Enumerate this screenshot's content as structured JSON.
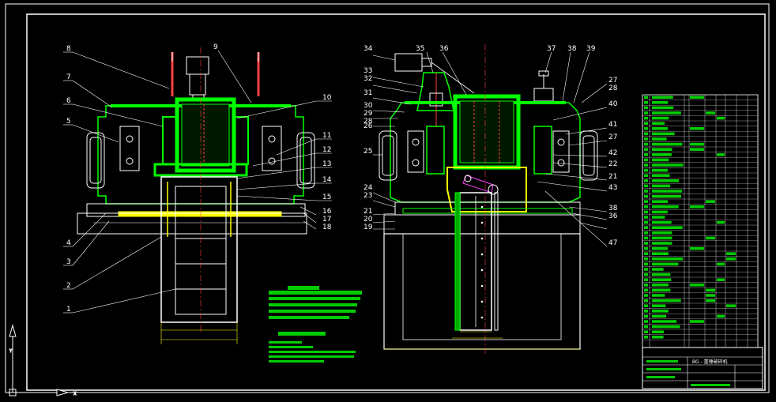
{
  "drawing": {
    "left_view_balloons": [
      "8",
      "9",
      "7",
      "6",
      "5",
      "10",
      "11",
      "12",
      "13",
      "14",
      "15",
      "16",
      "17",
      "18",
      "4",
      "3",
      "2",
      "1"
    ],
    "right_view_balloons": [
      "34",
      "35",
      "36",
      "37",
      "38",
      "39",
      "33",
      "32",
      "31",
      "30",
      "29",
      "28",
      "26",
      "25",
      "27",
      "28",
      "40",
      "41",
      "27",
      "42",
      "22",
      "21",
      "43",
      "24",
      "23",
      "21",
      "20",
      "19",
      "38",
      "36",
      "47"
    ],
    "title_block_text": "BG - 重锤破碎机"
  },
  "colors": {
    "background": "#000000",
    "frame": "#ffffff",
    "part": "#00ff00",
    "highlight": "#ffff00",
    "accent": "#ff4040"
  }
}
